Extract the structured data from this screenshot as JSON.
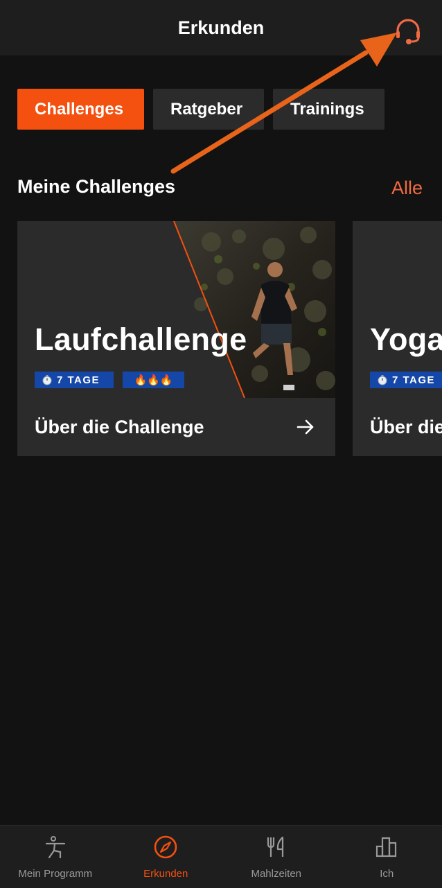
{
  "header": {
    "title": "Erkunden",
    "support_icon": "headset-icon"
  },
  "tabs": [
    {
      "label": "Challenges",
      "active": true
    },
    {
      "label": "Ratgeber",
      "active": false
    },
    {
      "label": "Trainings",
      "active": false
    }
  ],
  "section": {
    "title": "Meine Challenges",
    "see_all": "Alle"
  },
  "challenges": [
    {
      "title": "Laufchallenge",
      "duration": "7 TAGE",
      "difficulty": "🔥🔥🔥",
      "footer": "Über die Challenge"
    },
    {
      "title": "Yoga",
      "duration": "7 TAGE",
      "footer": "Über die"
    }
  ],
  "bottom_nav": [
    {
      "label": "Mein Programm",
      "icon": "person-exercise-icon",
      "active": false
    },
    {
      "label": "Erkunden",
      "icon": "compass-icon",
      "active": true
    },
    {
      "label": "Mahlzeiten",
      "icon": "fork-knife-icon",
      "active": false
    },
    {
      "label": "Ich",
      "icon": "bar-chart-icon",
      "active": false
    }
  ],
  "colors": {
    "accent": "#f4500f",
    "background": "#121212",
    "surface": "#2b2b2b",
    "badge": "#1447a8"
  }
}
